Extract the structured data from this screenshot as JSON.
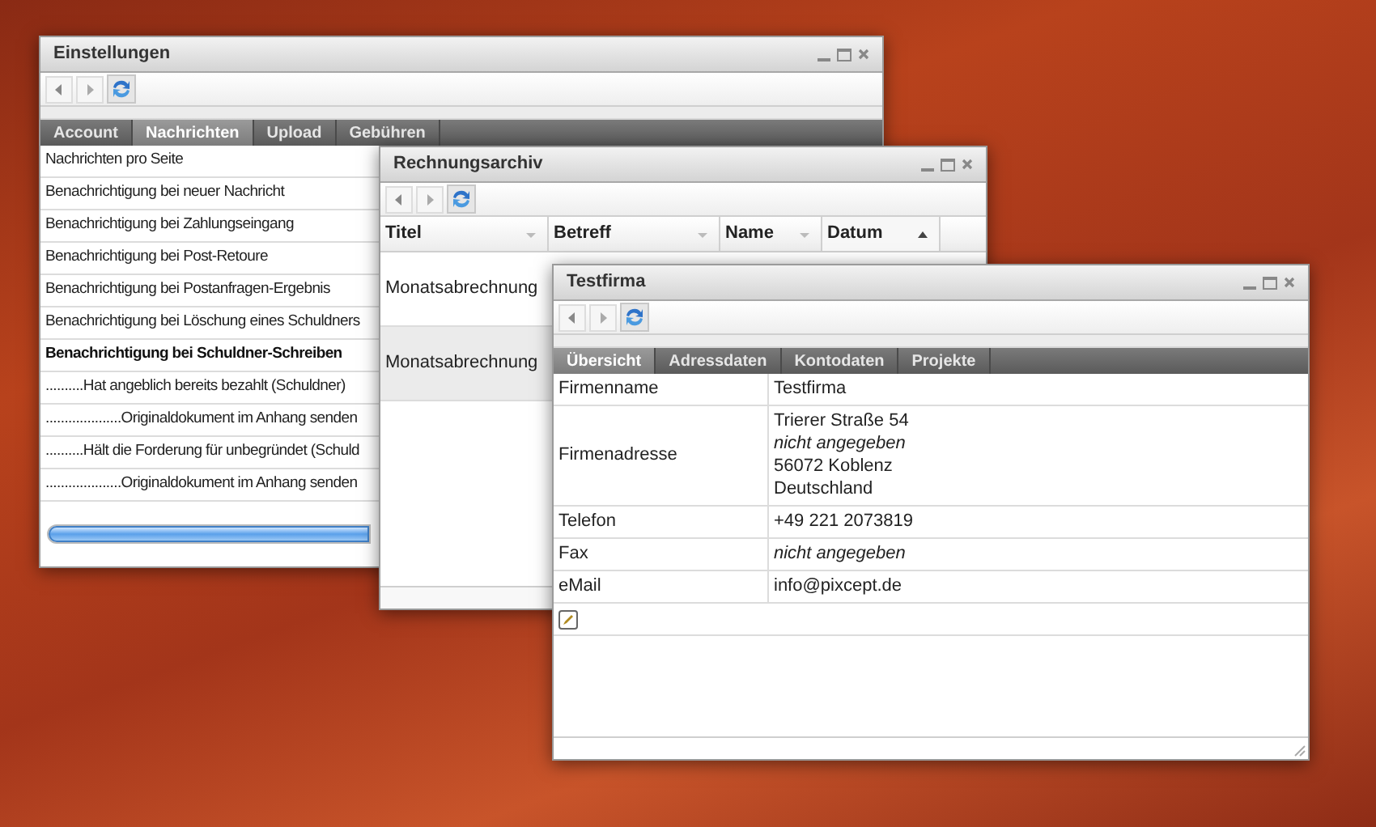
{
  "settings_window": {
    "title": "Einstellungen",
    "tabs": [
      {
        "label": "Account",
        "selected": false
      },
      {
        "label": "Nachrichten",
        "selected": true
      },
      {
        "label": "Upload",
        "selected": false
      },
      {
        "label": "Gebühren",
        "selected": false
      }
    ],
    "rows": [
      {
        "text": "Nachrichten pro Seite",
        "bold": false
      },
      {
        "text": "Benachrichtigung bei neuer Nachricht",
        "bold": false
      },
      {
        "text": "Benachrichtigung bei Zahlungseingang",
        "bold": false
      },
      {
        "text": "Benachrichtigung bei Post-Retoure",
        "bold": false
      },
      {
        "text": "Benachrichtigung bei Postanfragen-Ergebnis",
        "bold": false
      },
      {
        "text": "Benachrichtigung bei Löschung eines Schuldners",
        "bold": false
      },
      {
        "text": "Benachrichtigung bei Schuldner-Schreiben",
        "bold": true
      },
      {
        "text": "..........Hat angeblich bereits bezahlt (Schuldner)",
        "bold": false
      },
      {
        "text": "....................Originaldokument im Anhang senden",
        "bold": false
      },
      {
        "text": "..........Hält die Forderung für unbegründet (Schuld",
        "bold": false
      },
      {
        "text": "....................Originaldokument im Anhang senden",
        "bold": false
      }
    ]
  },
  "archive_window": {
    "title": "Rechnungsarchiv",
    "columns": [
      {
        "label": "Titel",
        "sorted": false
      },
      {
        "label": "Betreff",
        "sorted": false
      },
      {
        "label": "Name",
        "sorted": false
      },
      {
        "label": "Datum",
        "sorted": true
      }
    ],
    "rows": [
      {
        "title": "Monatsabrechnung",
        "selected": false
      },
      {
        "title": "Monatsabrechnung",
        "selected": true
      }
    ]
  },
  "company_window": {
    "title": "Testfirma",
    "tabs": [
      {
        "label": "Übersicht",
        "selected": true
      },
      {
        "label": "Adressdaten",
        "selected": false
      },
      {
        "label": "Kontodaten",
        "selected": false
      },
      {
        "label": "Projekte",
        "selected": false
      }
    ],
    "fields": [
      {
        "label": "Firmenname",
        "lines": [
          {
            "text": "Testfirma",
            "italic": false
          }
        ]
      },
      {
        "label": "Firmenadresse",
        "lines": [
          {
            "text": "Trierer Straße 54",
            "italic": false
          },
          {
            "text": "nicht angegeben",
            "italic": true
          },
          {
            "text": "56072 Koblenz",
            "italic": false
          },
          {
            "text": "Deutschland",
            "italic": false
          }
        ]
      },
      {
        "label": "Telefon",
        "lines": [
          {
            "text": "+49 221 2073819",
            "italic": false
          }
        ]
      },
      {
        "label": "Fax",
        "lines": [
          {
            "text": "nicht angegeben",
            "italic": true
          }
        ]
      },
      {
        "label": "eMail",
        "lines": [
          {
            "text": "info@pixcept.de",
            "italic": false
          }
        ]
      }
    ]
  }
}
